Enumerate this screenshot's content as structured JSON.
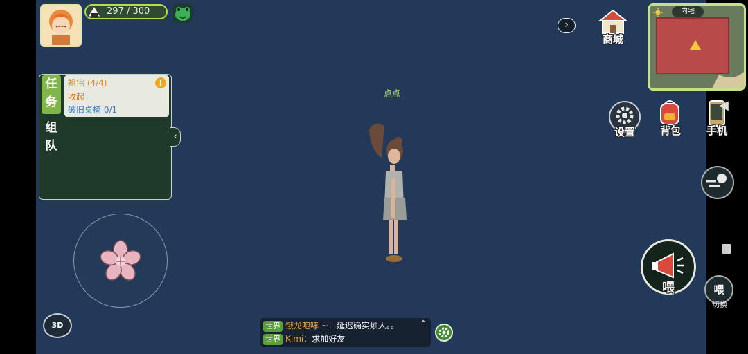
{
  "player": {
    "energy": "297 / 300",
    "name": "点点"
  },
  "task_panel": {
    "task_tab": "任务",
    "team_tab": "组队",
    "quest_title": "祖宅 (4/4)",
    "collapse_label": "收起",
    "quest_item": "破旧桌椅 0/1"
  },
  "buttons": {
    "shop": "商城",
    "settings": "设置",
    "backpack": "背包",
    "phone": "手机",
    "shout": "喂",
    "switch_icon": "喂",
    "switch_label": "切换",
    "mode_3d": "3D"
  },
  "minimap": {
    "title": "内宅"
  },
  "chat": {
    "messages": [
      {
        "channel": "世界",
        "sender": "饿龙咆哮 ~：",
        "text": "延迟确实烦人。。"
      },
      {
        "channel": "世界",
        "sender": "Kimi：",
        "text": "求加好友"
      }
    ]
  },
  "colors": {
    "scene_bg": "#23395a",
    "task_panel": "#1f3a2a",
    "accent_green": "#7fb54a",
    "quest_orange": "#e48a1c",
    "quest_blue": "#3a7acf"
  }
}
